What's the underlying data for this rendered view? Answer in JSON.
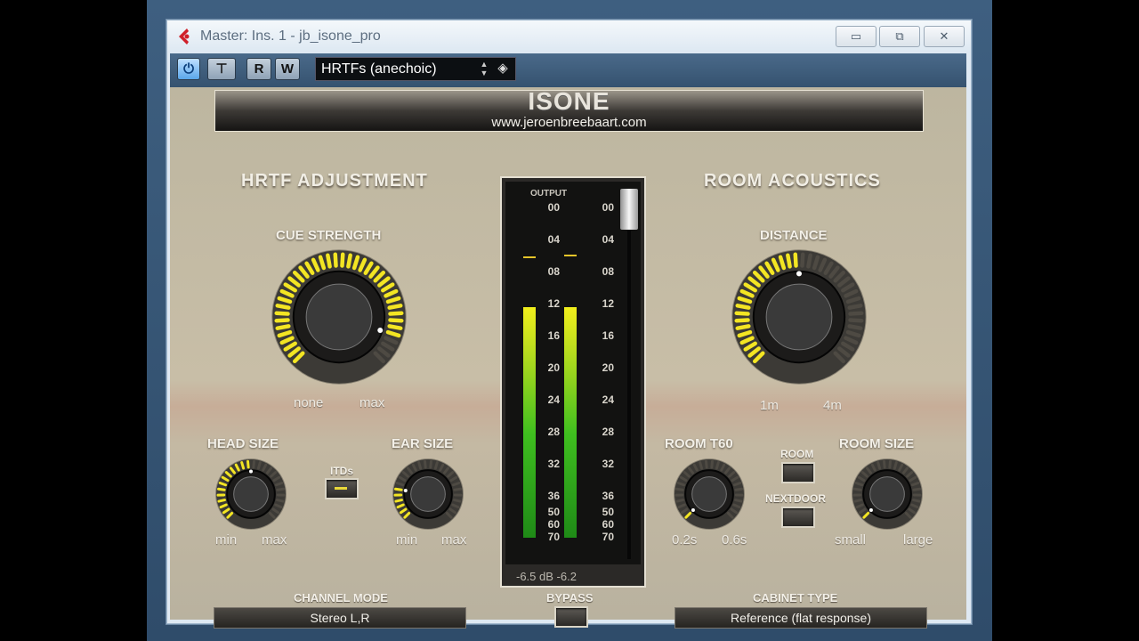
{
  "window": {
    "title": "Master: Ins. 1 - jb_isone_pro",
    "buttons": {
      "minimize": "▭",
      "maximize": "⧉",
      "close": "✕"
    }
  },
  "toolbar": {
    "power_label": "⏻",
    "compare_label": "⊤",
    "read_label": "R",
    "write_label": "W",
    "preset": "HRTFs (anechoic)"
  },
  "plugin": {
    "logo": "ISONE",
    "url": "www.jeroenbreebaart.com",
    "hrtf": {
      "title": "HRTF  ADJUSTMENT",
      "cue_strength": {
        "label": "CUE  STRENGTH",
        "min": "none",
        "max": "max",
        "value": 0.9
      },
      "head_size": {
        "label": "HEAD  SIZE",
        "min": "min",
        "max": "max",
        "value": 0.5
      },
      "itds": {
        "label": "ITDs",
        "on": true
      },
      "ear_size": {
        "label": "EAR  SIZE",
        "min": "min",
        "max": "max",
        "value": 0.2
      },
      "channel_mode": {
        "label": "CHANNEL  MODE",
        "value": "Stereo L,R"
      }
    },
    "meter": {
      "label": "OUTPUT",
      "scale": [
        "00",
        "04",
        "08",
        "12",
        "16",
        "20",
        "24",
        "28",
        "32",
        "36",
        "50",
        "60",
        "70"
      ],
      "left_level": 0.7,
      "right_level": 0.7,
      "readout_left": "-6.5 dB",
      "readout_right": "-6.2"
    },
    "bypass": {
      "label": "BYPASS"
    },
    "room": {
      "title": "ROOM  ACOUSTICS",
      "distance": {
        "label": "DISTANCE",
        "min": "1m",
        "max": "4m",
        "value": 0.5
      },
      "room_t60": {
        "label": "ROOM  T60",
        "min": "0.2s",
        "max": "0.6s",
        "value": 0.0
      },
      "room_btn": {
        "label": "ROOM"
      },
      "nextdoor_btn": {
        "label": "NEXTDOOR"
      },
      "room_size": {
        "label": "ROOM  SIZE",
        "min": "small",
        "max": "large",
        "value": 0.0
      },
      "cabinet_type": {
        "label": "CABINET  TYPE",
        "value": "Reference (flat response)"
      }
    }
  },
  "colors": {
    "led_on": "#f3e523",
    "led_off": "#4e4a43",
    "panel": "#c2b9a3"
  }
}
